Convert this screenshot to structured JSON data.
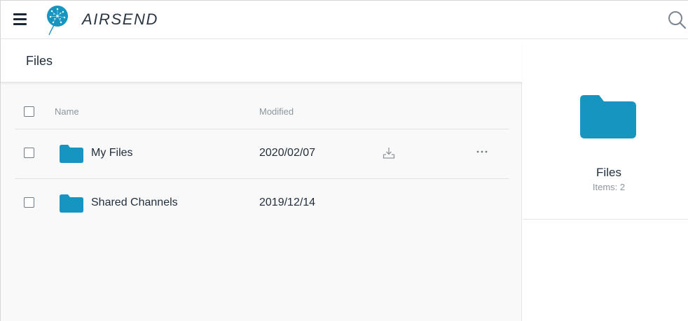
{
  "app": {
    "brand": "AIRSEND",
    "accent": "#1595c0"
  },
  "header": {
    "menu_icon": "hamburger-icon",
    "search_icon": "search-icon"
  },
  "files_panel": {
    "title": "Files",
    "columns": {
      "name": "Name",
      "modified": "Modified"
    },
    "rows": [
      {
        "name": "My Files",
        "modified": "2020/02/07",
        "icon": "folder-icon",
        "has_actions": true
      },
      {
        "name": "Shared Channels",
        "modified": "2019/12/14",
        "icon": "folder-icon",
        "has_actions": false
      }
    ]
  },
  "details_panel": {
    "title": "Files",
    "items_text": "Items: 2",
    "icon": "folder-icon"
  }
}
